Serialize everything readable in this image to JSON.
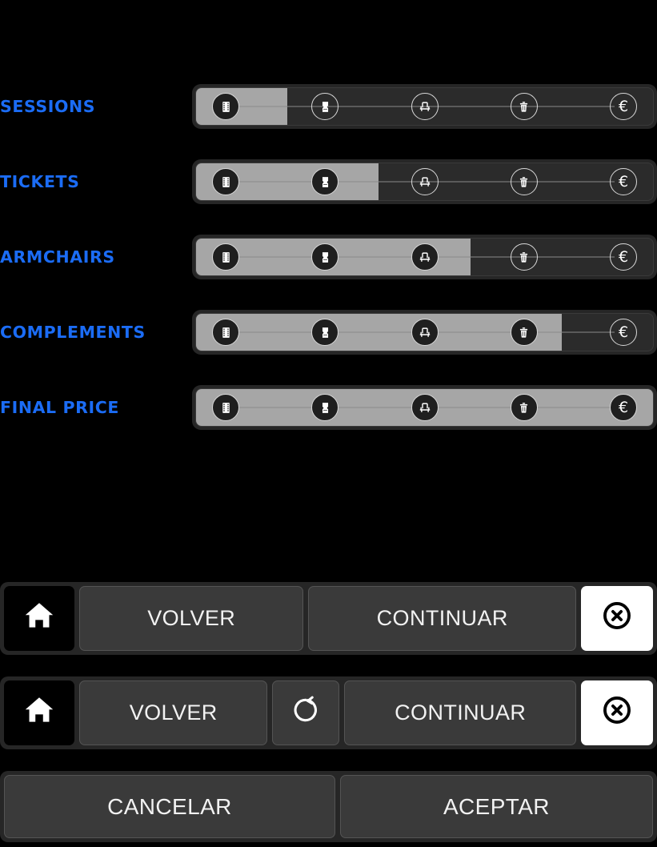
{
  "theme": {
    "background": "#000000",
    "label_blue": "#1b6cf5",
    "fill_gray": "#a6a6a6",
    "track_dark": "#2b2b2b",
    "bar_bg": "#262626",
    "button_bg": "#3a3a3a",
    "text_white": "#f2f2f2"
  },
  "progress": {
    "steps": [
      {
        "id": "sessions",
        "icon": "film-icon"
      },
      {
        "id": "tickets",
        "icon": "ticket-icon"
      },
      {
        "id": "armchairs",
        "icon": "armchair-icon"
      },
      {
        "id": "complements",
        "icon": "trash-icon"
      },
      {
        "id": "final-price",
        "icon": "euro-icon"
      }
    ],
    "rows": [
      {
        "label": "SESSIONS",
        "completed": 1,
        "fill_percent": 20
      },
      {
        "label": "TICKETS",
        "completed": 2,
        "fill_percent": 40
      },
      {
        "label": "ARMCHAIRS",
        "completed": 3,
        "fill_percent": 60
      },
      {
        "label": "COMPLEMENTS",
        "completed": 4,
        "fill_percent": 80
      },
      {
        "label": "FINAL PRICE",
        "completed": 5,
        "fill_percent": 100
      }
    ]
  },
  "bars": {
    "primary": {
      "home_icon": "home-icon",
      "back_label": "VOLVER",
      "continue_label": "CONTINUAR",
      "close_icon": "close-circle-icon"
    },
    "secondary": {
      "home_icon": "home-icon",
      "back_label": "VOLVER",
      "reset_icon": "refresh-icon",
      "continue_label": "CONTINUAR",
      "close_icon": "close-circle-icon"
    },
    "confirm": {
      "cancel_label": "CANCELAR",
      "accept_label": "ACEPTAR"
    }
  }
}
